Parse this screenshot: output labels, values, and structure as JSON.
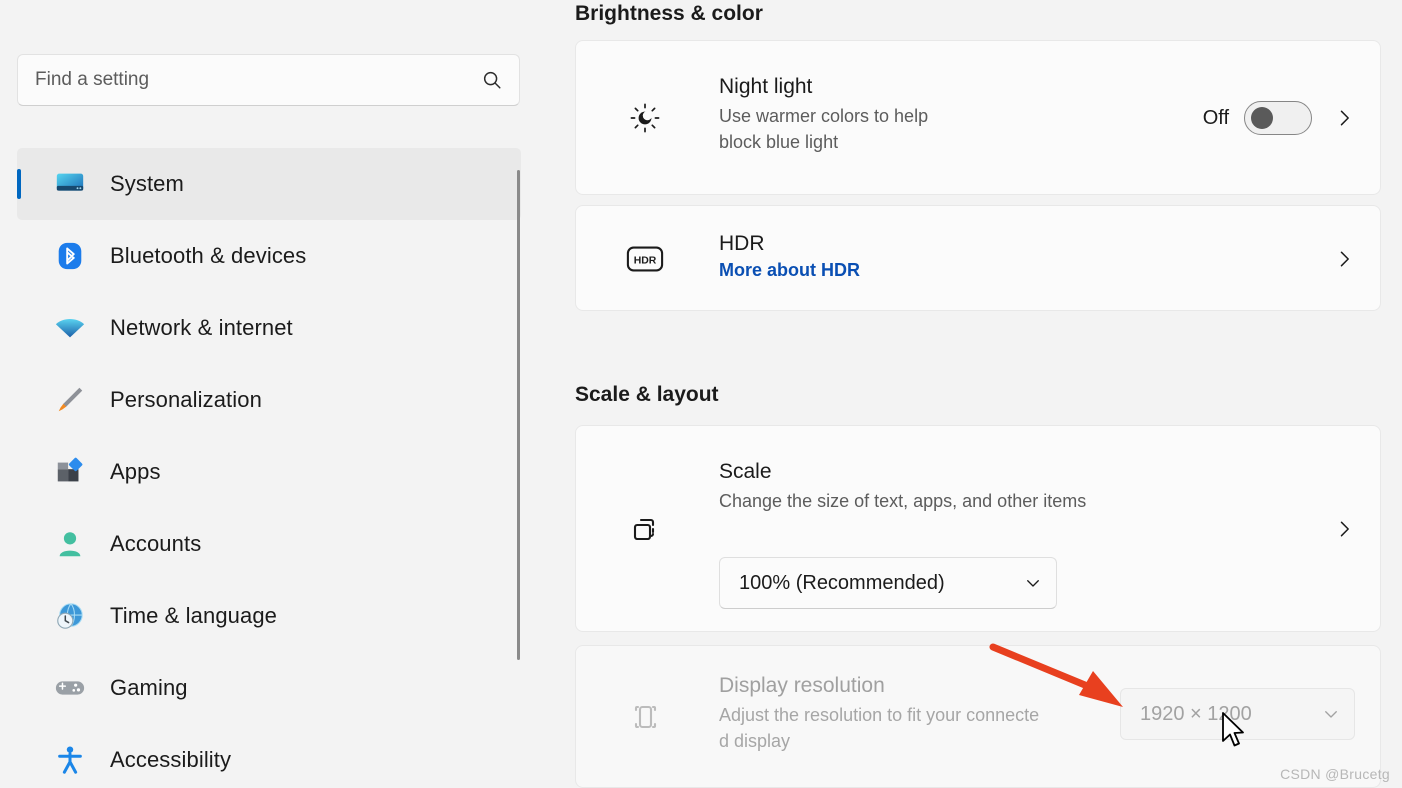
{
  "search": {
    "placeholder": "Find a setting",
    "value": "",
    "icon": "search-icon"
  },
  "sidebar": {
    "items": [
      {
        "label": "System",
        "icon": "monitor-icon",
        "selected": true
      },
      {
        "label": "Bluetooth & devices",
        "icon": "bluetooth-icon",
        "selected": false
      },
      {
        "label": "Network & internet",
        "icon": "wifi-icon",
        "selected": false
      },
      {
        "label": "Personalization",
        "icon": "paintbrush-icon",
        "selected": false
      },
      {
        "label": "Apps",
        "icon": "apps-icon",
        "selected": false
      },
      {
        "label": "Accounts",
        "icon": "person-icon",
        "selected": false
      },
      {
        "label": "Time & language",
        "icon": "clock-globe-icon",
        "selected": false
      },
      {
        "label": "Gaming",
        "icon": "gamepad-icon",
        "selected": false
      },
      {
        "label": "Accessibility",
        "icon": "accessibility-icon",
        "selected": false
      }
    ]
  },
  "main": {
    "sections": {
      "brightness": {
        "title": "Brightness & color"
      },
      "scale": {
        "title": "Scale & layout"
      }
    },
    "night_light": {
      "title": "Night light",
      "subtitle_line1": "Use warmer colors to help",
      "subtitle_line2": "block blue light",
      "toggle_state": "Off",
      "icon": "brightness-sun-icon",
      "chevron": "chevron-right-icon"
    },
    "hdr": {
      "title": "HDR",
      "link": "More about HDR",
      "icon": "hdr-badge-icon",
      "chevron": "chevron-right-icon"
    },
    "scale": {
      "title": "Scale",
      "subtitle": "Change the size of text, apps, and other items",
      "value": "100% (Recommended)",
      "icon": "scale-resize-icon",
      "chevron": "chevron-right-icon"
    },
    "display_resolution": {
      "title": "Display resolution",
      "subtitle_line1": "Adjust the resolution to fit your connecte",
      "subtitle_line2": "d display",
      "value": "1920 × 1200",
      "icon": "display-icon",
      "disabled": true
    }
  },
  "annotations": {
    "arrow_color": "#e8401f",
    "watermark": "CSDN @Brucetg"
  },
  "colors": {
    "accent": "#0067c0",
    "page_bg": "#f3f3f3",
    "card_bg": "#fbfbfb",
    "link": "#0a4fb3"
  }
}
